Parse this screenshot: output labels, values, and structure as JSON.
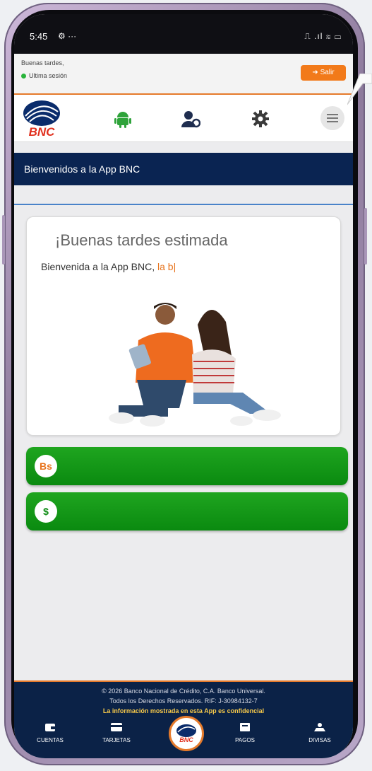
{
  "status_bar": {
    "time": "5:45",
    "icons": "⚙ ···",
    "right": "⎍ .ıl ≋ ▭"
  },
  "greeting": {
    "line1": "Buenas tardes,",
    "line2": "Ultima sesión"
  },
  "logout_label": "Salir",
  "title_band": "Bienvenidos a la App BNC",
  "card": {
    "heading": "¡Buenas tardes estimada",
    "subheading": "Bienvenida a la App BNC,",
    "name": "la b|"
  },
  "currency_bars": [
    {
      "symbol": "Bs"
    },
    {
      "symbol": "$"
    }
  ],
  "footer": {
    "copyright": "© 2026 Banco Nacional de Crédito, C.A. Banco Universal.",
    "rights": "Todos los Derechos Reservados. RIF: J-30984132-7",
    "confidential": "La información mostrada en esta App es confidencial"
  },
  "tabs": {
    "cuentas": "CUENTAS",
    "tarjetas": "TARJETAS",
    "pagos": "PAGOS",
    "divisas": "DIVISAS"
  },
  "logo_text": "BNC",
  "colors": {
    "navy": "#0a2452",
    "orange": "#e57a2b",
    "green": "#129a17"
  }
}
